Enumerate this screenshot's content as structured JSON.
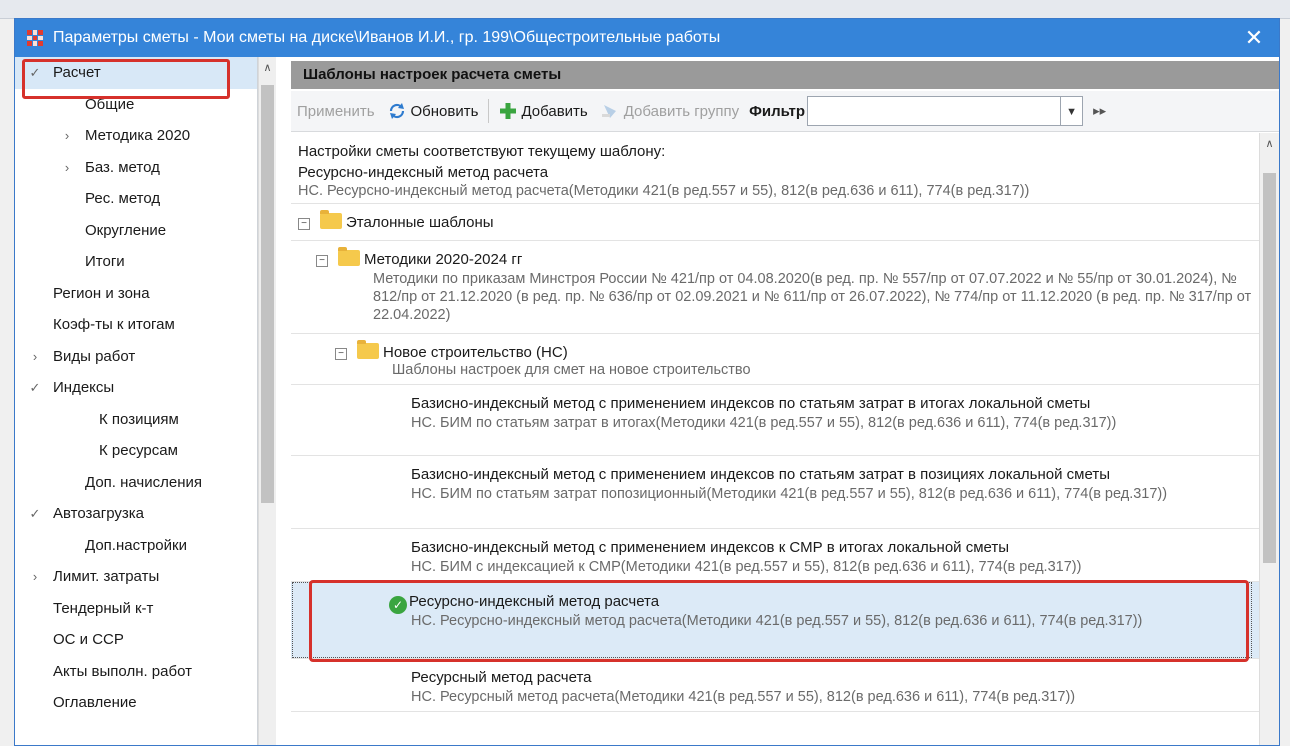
{
  "window": {
    "title": "Параметры сметы - Мои сметы на диске\\Иванов И.И., гр. 199\\Общестроительные работы",
    "close_glyph": "✕"
  },
  "sidebar": {
    "items": [
      {
        "label": "Расчет",
        "chevron": "✓",
        "level": 0,
        "selected": true
      },
      {
        "label": "Общие",
        "chevron": "",
        "level": 2
      },
      {
        "label": "Методика 2020",
        "chevron": "›",
        "level": 1
      },
      {
        "label": "Баз. метод",
        "chevron": "›",
        "level": 1
      },
      {
        "label": "Рес. метод",
        "chevron": "",
        "level": 2
      },
      {
        "label": "Округление",
        "chevron": "",
        "level": 2
      },
      {
        "label": "Итоги",
        "chevron": "",
        "level": 2
      },
      {
        "label": "Регион и зона",
        "chevron": "",
        "level": 0
      },
      {
        "label": "Коэф-ты к итогам",
        "chevron": "",
        "level": 0
      },
      {
        "label": "Виды работ",
        "chevron": "›",
        "level": 0
      },
      {
        "label": "Индексы",
        "chevron": "✓",
        "level": 0
      },
      {
        "label": "К позициям",
        "chevron": "",
        "level": 3
      },
      {
        "label": "К ресурсам",
        "chevron": "",
        "level": 3
      },
      {
        "label": "Доп. начисления",
        "chevron": "",
        "level": 2
      },
      {
        "label": "Автозагрузка",
        "chevron": "✓",
        "level": 0
      },
      {
        "label": "Доп.настройки",
        "chevron": "",
        "level": 2
      },
      {
        "label": "Лимит. затраты",
        "chevron": "›",
        "level": 0
      },
      {
        "label": "Тендерный к-т",
        "chevron": "",
        "level": 0
      },
      {
        "label": "ОС и ССР",
        "chevron": "",
        "level": 0
      },
      {
        "label": "Акты выполн. работ",
        "chevron": "",
        "level": 0
      },
      {
        "label": "Оглавление",
        "chevron": "",
        "level": 0
      }
    ]
  },
  "panel": {
    "header": "Шаблоны настроек расчета сметы"
  },
  "toolbar": {
    "apply": "Применить",
    "refresh": "Обновить",
    "add": "Добавить",
    "add_group": "Добавить группу",
    "filter_label": "Фильтр",
    "filter_value": ""
  },
  "content": {
    "status_line1": "Настройки сметы соответствуют текущему шаблону:",
    "status_line2": "Ресурсно-индексный метод расчета",
    "status_line3": "НС. Ресурсно-индексный метод расчета(Методики 421(в ред.557 и 55), 812(в ред.636 и 611), 774(в ред.317))",
    "group_etalon": "Эталонные шаблоны",
    "group_methods": "Методики 2020-2024 гг",
    "group_methods_desc": "Методики по приказам Минстроя России № 421/пр от 04.08.2020(в ред. пр. № 557/пр от 07.07.2022 и № 55/пр от 30.01.2024), № 812/пр от 21.12.2020 (в ред. пр. № 636/пр от 02.09.2021 и № 611/пр от 26.07.2022), № 774/пр от 11.12.2020 (в ред. пр. № 317/пр от 22.04.2022)",
    "group_new": "Новое строительство (НС)",
    "group_new_desc": "Шаблоны настроек для смет на новое строительство",
    "templates": [
      {
        "title": "Базисно-индексный метод с применением индексов по статьям затрат в итогах локальной сметы",
        "desc": "НС. БИМ по статьям затрат в итогах(Методики 421(в ред.557 и 55), 812(в ред.636 и 611), 774(в ред.317))"
      },
      {
        "title": "Базисно-индексный метод с применением индексов по статьям затрат в позициях локальной сметы",
        "desc": "НС. БИМ по статьям затрат попозиционный(Методики 421(в ред.557 и 55), 812(в ред.636 и 611), 774(в ред.317))"
      },
      {
        "title": "Базисно-индексный метод с применением индексов к СМР в итогах локальной сметы",
        "desc": "НС. БИМ с индексацией к СМР(Методики 421(в ред.557 и 55), 812(в ред.636 и 611), 774(в ред.317))"
      },
      {
        "title": "Ресурсно-индексный метод расчета",
        "desc": "НС. Ресурсно-индексный метод расчета(Методики 421(в ред.557 и 55), 812(в ред.636 и 611), 774(в ред.317))"
      },
      {
        "title": "Ресурсный метод расчета",
        "desc": "НС. Ресурсный метод расчета(Методики 421(в ред.557 и 55), 812(в ред.636 и 611), 774(в ред.317))"
      }
    ]
  },
  "icons": {
    "refresh": "refresh-icon",
    "add": "plus-icon",
    "add_group": "add-group-icon",
    "check": "check-circle-icon",
    "folder": "folder-icon"
  }
}
